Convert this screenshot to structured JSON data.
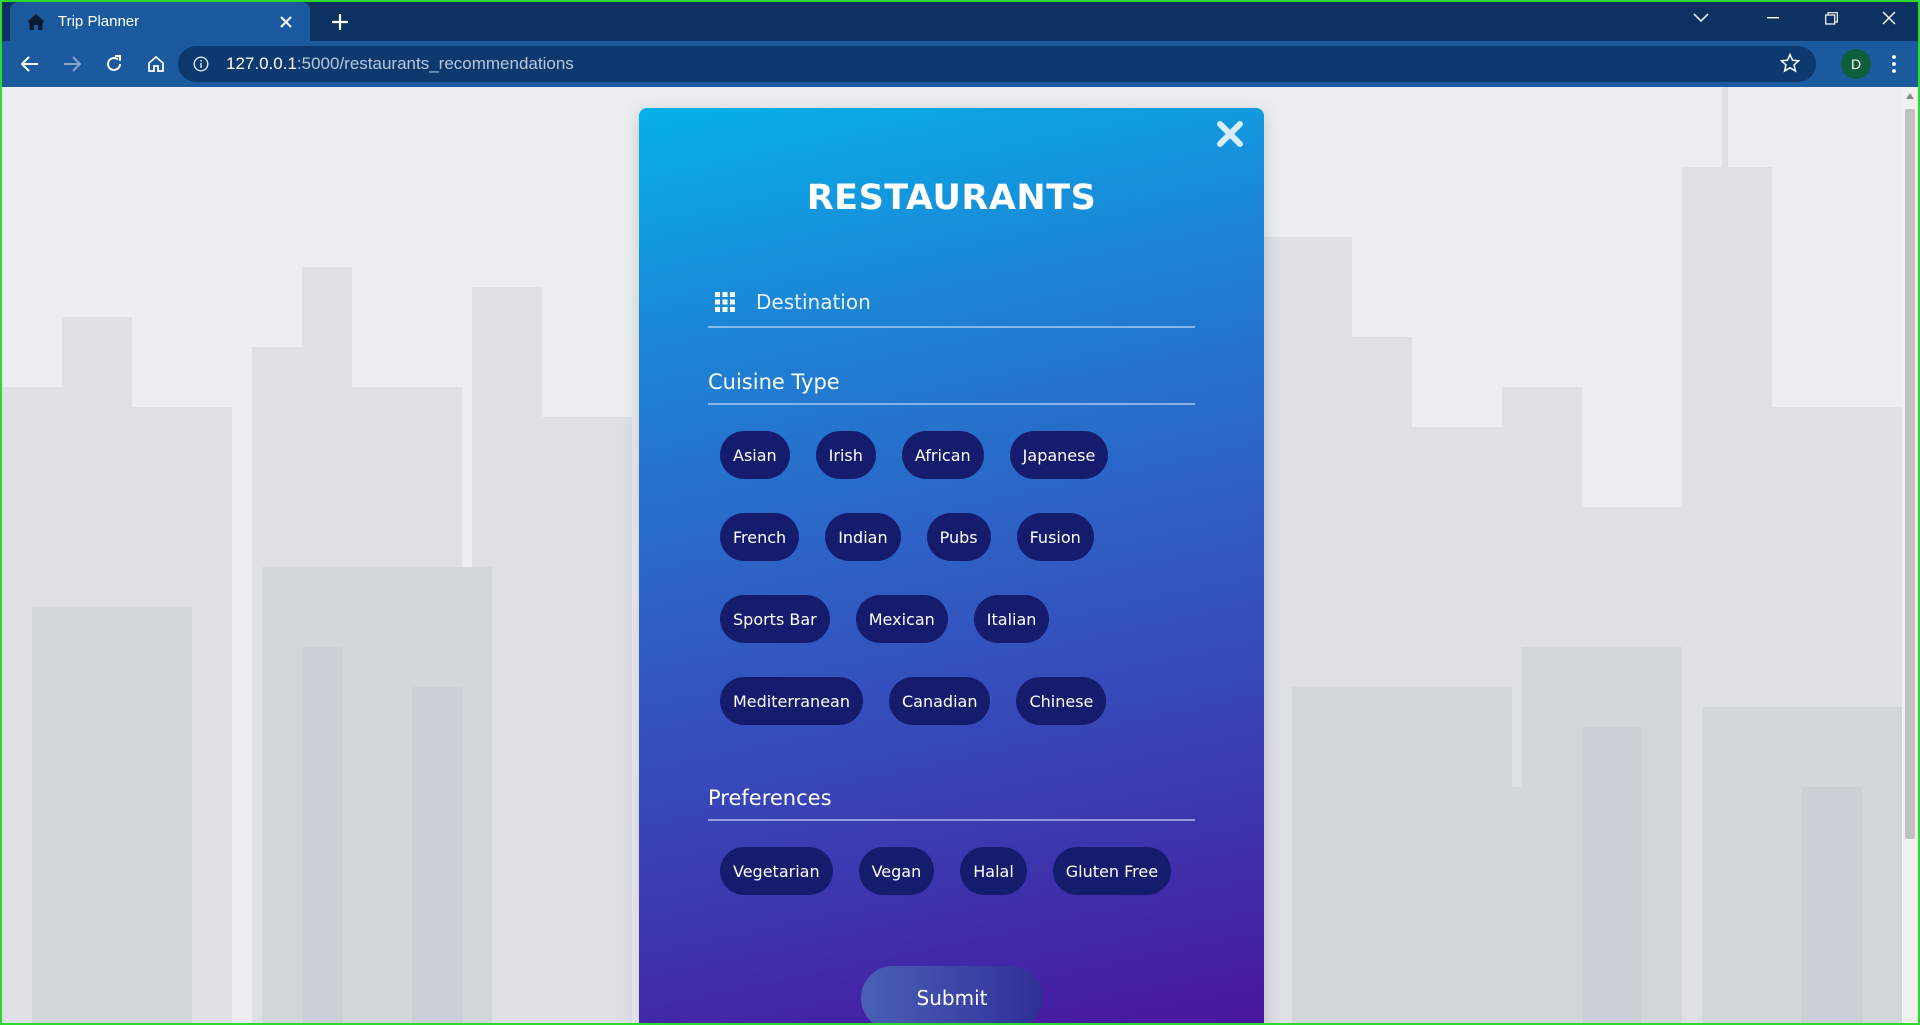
{
  "browser": {
    "tab_title": "Trip Planner",
    "tab_icon": "home-icon",
    "url_host": "127.0.0.1",
    "url_path": ":5000/restaurants_recommendations",
    "profile_initial": "D"
  },
  "modal": {
    "title": "RESTAURANTS",
    "destination_placeholder": "Destination",
    "cuisine_label": "Cuisine Type",
    "cuisine_rows": [
      [
        "Asian",
        "Irish",
        "African",
        "Japanese"
      ],
      [
        "French",
        "Indian",
        "Pubs",
        "Fusion"
      ],
      [
        "Sports Bar",
        "Mexican",
        "Italian"
      ],
      [
        "Mediterranean",
        "Canadian",
        "Chinese"
      ]
    ],
    "preferences_label": "Preferences",
    "preferences": [
      "Vegetarian",
      "Vegan",
      "Halal",
      "Gluten Free"
    ],
    "submit_label": "Submit"
  },
  "colors": {
    "chip_bg": "#151c6e",
    "card_gradient_top": "#06b1e8",
    "card_gradient_bottom": "#4a129e",
    "browser_frame": "#0b3260",
    "toolbar": "#1c5a9f"
  }
}
